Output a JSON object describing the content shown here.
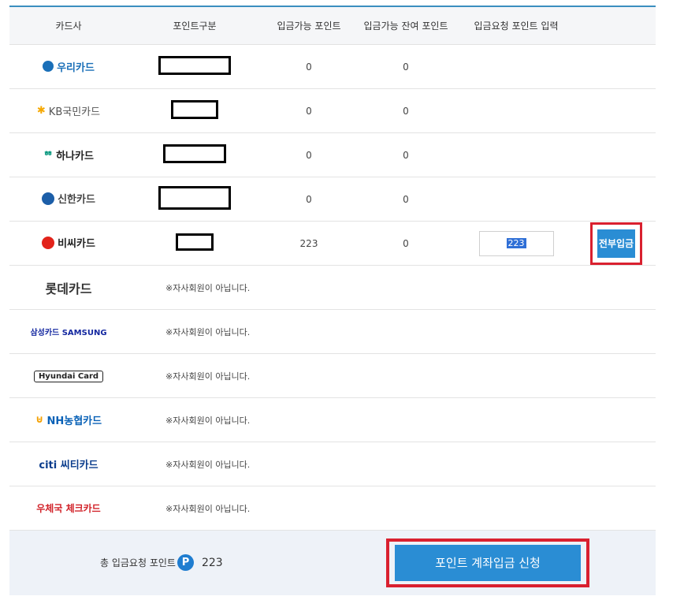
{
  "table": {
    "headers": [
      "카드사",
      "포인트구분",
      "입금가능 포인트",
      "입금가능 잔여 포인트",
      "입금요청 포인트 입력"
    ],
    "rows": [
      {
        "card": "우리카드",
        "color": "#1a6fb8",
        "available": "0",
        "remaining": "0"
      },
      {
        "card": "KB국민카드",
        "color": "#f6a800",
        "available": "0",
        "remaining": "0"
      },
      {
        "card": "하나카드",
        "color": "#00957a",
        "available": "0",
        "remaining": "0"
      },
      {
        "card": "신한카드",
        "color": "#1c5ea8",
        "available": "0",
        "remaining": "0"
      },
      {
        "card": "비씨카드",
        "color": "#e2231a",
        "available": "223",
        "remaining": "0",
        "input_value": "223",
        "all_button": "전부입금"
      }
    ],
    "non_member_rows": [
      {
        "card": "롯데카드",
        "color": "#333333",
        "notice": "※자사회원이 아닙니다."
      },
      {
        "card": "삼성카드 SAMSUNG",
        "color": "#1428a0",
        "notice": "※자사회원이 아닙니다."
      },
      {
        "card": "Hyundai Card",
        "color": "#222222",
        "notice": "※자사회원이 아닙니다."
      },
      {
        "card": "NH농협카드",
        "color": "#0a62b7",
        "notice": "※자사회원이 아닙니다."
      },
      {
        "card": "citi 씨티카드",
        "color": "#0a3c8c",
        "notice": "※자사회원이 아닙니다."
      },
      {
        "card": "우체국 체크카드",
        "color": "#d2232a",
        "notice": "※자사회원이 아닙니다."
      }
    ]
  },
  "footer": {
    "total_label": "총 입금요청 포인트",
    "badge": "P",
    "total_value": "223",
    "submit_label": "포인트 계좌입금 신청"
  },
  "colors": {
    "accent": "#2a8dd4",
    "highlight": "#d9202f",
    "footer_bg": "#eef2f8"
  }
}
